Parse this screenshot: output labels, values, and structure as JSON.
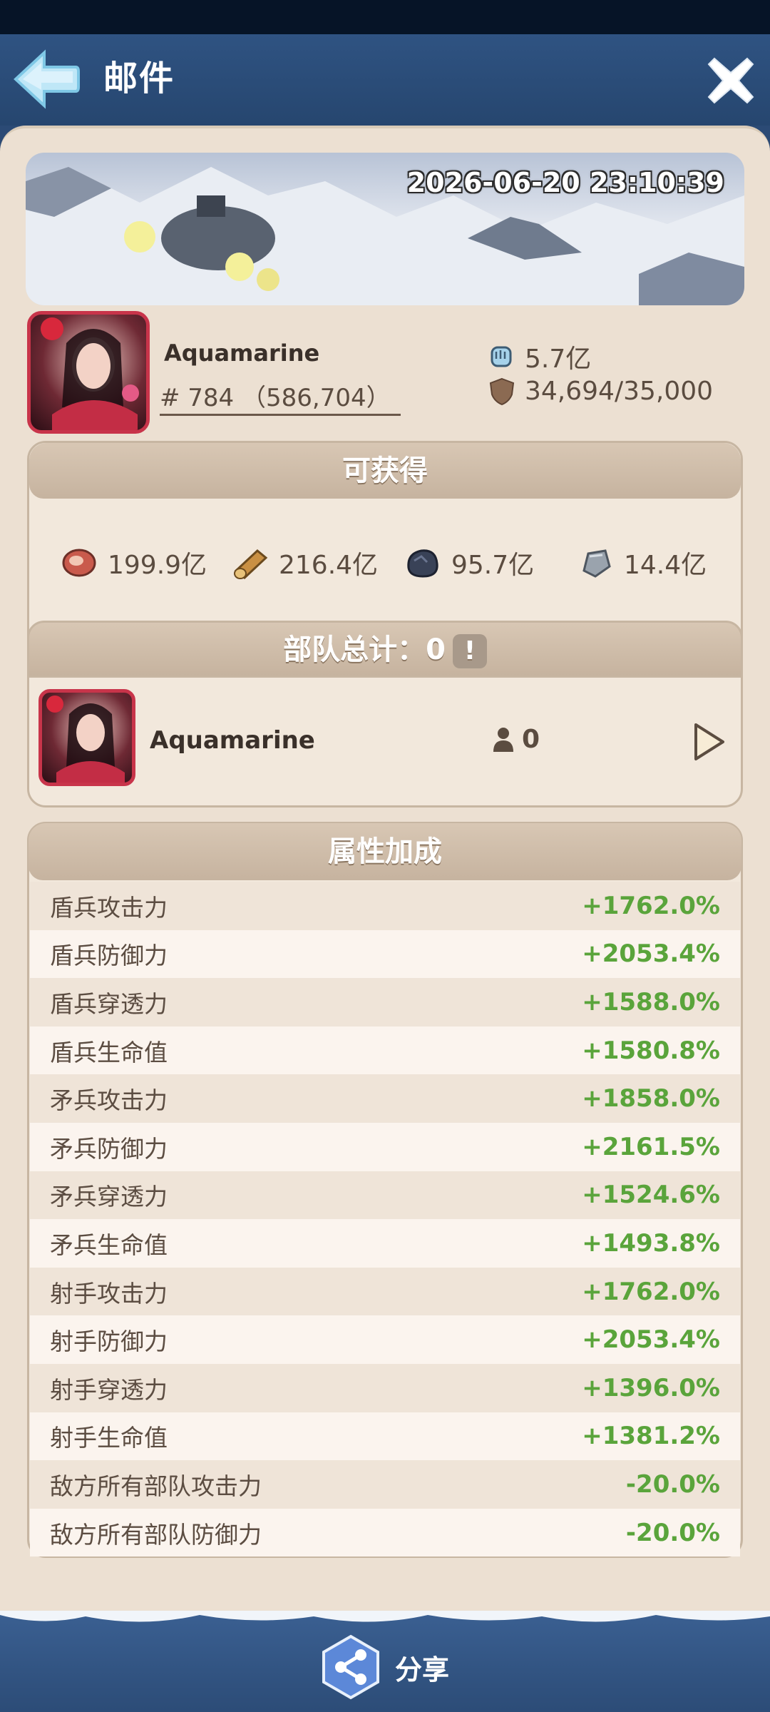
{
  "header": {
    "title": "邮件",
    "back_icon": "back-arrow-icon",
    "close_icon": "close-icon"
  },
  "banner": {
    "timestamp": "2026-06-20 23:10:39"
  },
  "player": {
    "name": "Aquamarine",
    "rank": "# 784 （586,704）",
    "power": "5.7亿",
    "shield": "34,694/35,000"
  },
  "rewards": {
    "title": "可获得",
    "items": [
      {
        "icon": "meat-icon",
        "value": "199.9亿"
      },
      {
        "icon": "wood-icon",
        "value": "216.4亿"
      },
      {
        "icon": "coal-icon",
        "value": "95.7亿"
      },
      {
        "icon": "iron-icon",
        "value": "14.4亿"
      }
    ]
  },
  "troops": {
    "title": "部队总计：0",
    "warn": "!",
    "hero_name": "Aquamarine",
    "count": "0"
  },
  "attributes": {
    "title": "属性加成",
    "rows": [
      {
        "label": "盾兵攻击力",
        "value": "+1762.0%"
      },
      {
        "label": "盾兵防御力",
        "value": "+2053.4%"
      },
      {
        "label": "盾兵穿透力",
        "value": "+1588.0%"
      },
      {
        "label": "盾兵生命值",
        "value": "+1580.8%"
      },
      {
        "label": "矛兵攻击力",
        "value": "+1858.0%"
      },
      {
        "label": "矛兵防御力",
        "value": "+2161.5%"
      },
      {
        "label": "矛兵穿透力",
        "value": "+1524.6%"
      },
      {
        "label": "矛兵生命值",
        "value": "+1493.8%"
      },
      {
        "label": "射手攻击力",
        "value": "+1762.0%"
      },
      {
        "label": "射手防御力",
        "value": "+2053.4%"
      },
      {
        "label": "射手穿透力",
        "value": "+1396.0%"
      },
      {
        "label": "射手生命值",
        "value": "+1381.2%"
      },
      {
        "label": "敌方所有部队攻击力",
        "value": "-20.0%"
      },
      {
        "label": "敌方所有部队防御力",
        "value": "-20.0%"
      }
    ]
  },
  "footer": {
    "share_label": "分享",
    "share_icon": "share-icon"
  },
  "colors": {
    "header_bg": "#2f5382",
    "panel_bg": "#ece0d2",
    "positive_value": "#5aa43b",
    "avatar_border": "#c8344a"
  }
}
